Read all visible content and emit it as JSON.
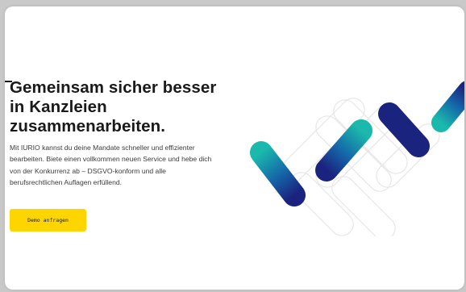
{
  "hero": {
    "headline": "Gemeinsam sicher besser in Kanzleien zusammenarbeiten.",
    "description": "Mit IURIO kannst du deine Mandate schneller und effizienter bearbeiten. Biete einen vollkommen neuen Service und hebe dich von der Konkurrenz ab – DSGVO-konform und alle berufsrechtlichen Auflagen erfüllend.",
    "cta_label": "Demo anfragen"
  },
  "colors": {
    "background": "#ffffff",
    "cta": "#ffd500",
    "text": "#1a1a1a",
    "teal": "#1bb8ac",
    "navy": "#1a237e"
  },
  "illustration": "iurio-logo-pattern"
}
